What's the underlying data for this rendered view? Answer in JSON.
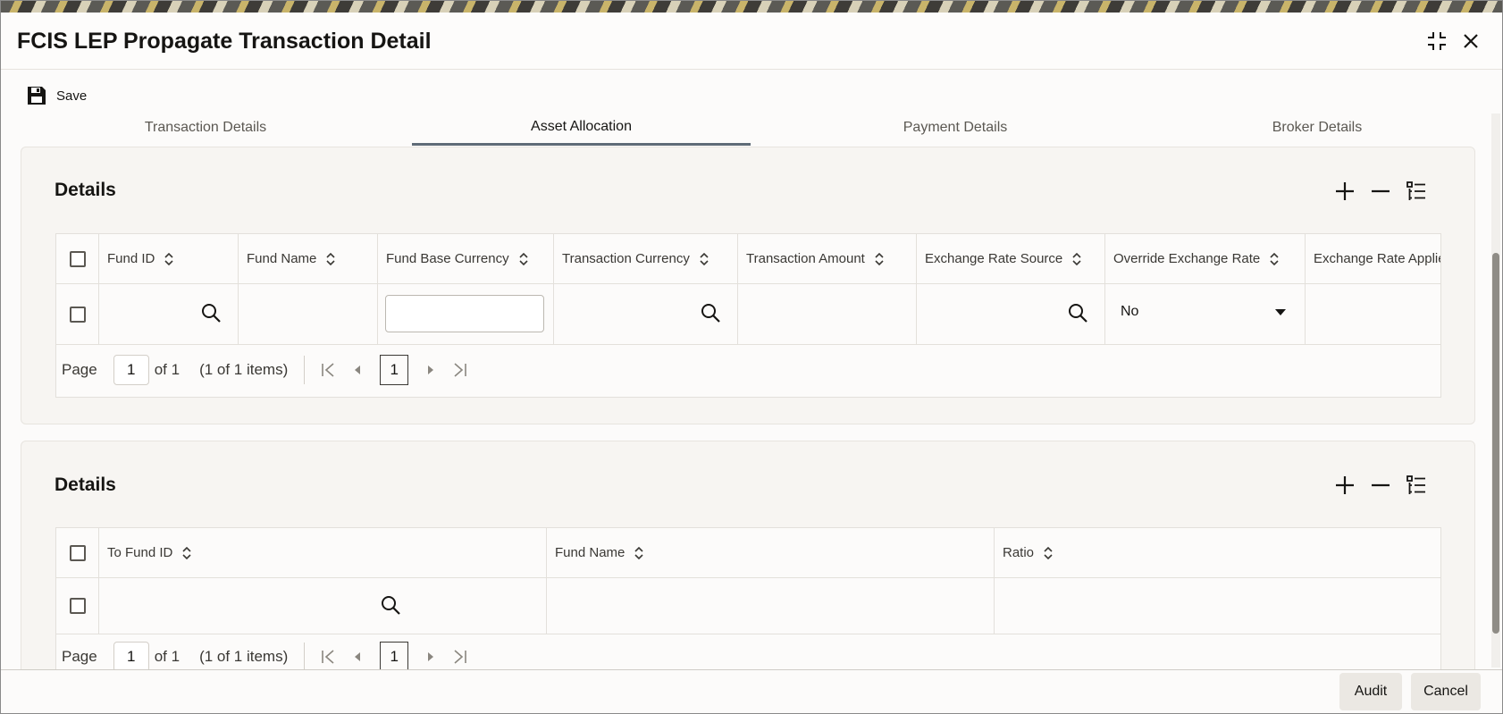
{
  "window": {
    "title": "FCIS LEP Propagate Transaction Detail"
  },
  "toolbar": {
    "save_label": "Save"
  },
  "tabs": [
    {
      "label": "Transaction Details",
      "active": false
    },
    {
      "label": "Asset Allocation",
      "active": true
    },
    {
      "label": "Payment Details",
      "active": false
    },
    {
      "label": "Broker Details",
      "active": false
    }
  ],
  "panel1": {
    "title": "Details",
    "columns": [
      "Fund ID",
      "Fund Name",
      "Fund Base Currency",
      "Transaction Currency",
      "Transaction Amount",
      "Exchange Rate Source",
      "Override Exchange Rate",
      "Exchange Rate Applie"
    ],
    "row": {
      "override_exchange_rate": "No"
    },
    "pager": {
      "page_label": "Page",
      "page_value": "1",
      "of_label": "of 1",
      "items_label": "(1 of 1 items)",
      "current": "1"
    }
  },
  "panel2": {
    "title": "Details",
    "columns": [
      "To Fund ID",
      "Fund Name",
      "Ratio"
    ],
    "pager": {
      "page_label": "Page",
      "page_value": "1",
      "of_label": "of 1",
      "items_label": "(1 of 1 items)",
      "current": "1"
    }
  },
  "footer": {
    "audit_label": "Audit",
    "cancel_label": "Cancel"
  },
  "colors": {
    "active_tab_underline": "#5f6b77",
    "panel_bg": "#f7f5f2",
    "button_bg": "#ebe8e3"
  },
  "icons": [
    "save-icon",
    "minimize-icon",
    "close-icon",
    "add-icon",
    "remove-icon",
    "column-list-icon",
    "sort-icon",
    "search-icon",
    "dropdown-icon",
    "first-page-icon",
    "prev-page-icon",
    "next-page-icon",
    "last-page-icon"
  ]
}
